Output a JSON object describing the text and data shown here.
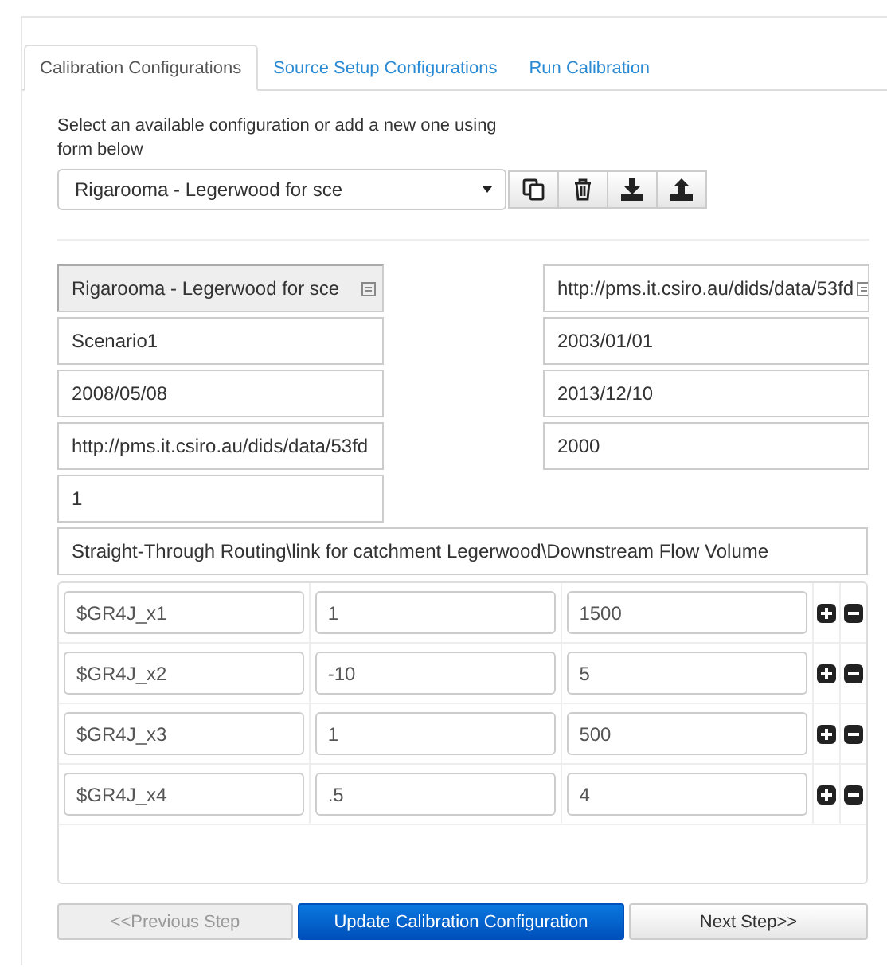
{
  "tabs": [
    {
      "label": "Calibration Configurations",
      "selected": true
    },
    {
      "label": "Source Setup Configurations",
      "selected": false
    },
    {
      "label": "Run Calibration",
      "selected": false
    }
  ],
  "intro": "Select an available configuration or add a new one using form below",
  "config_select": {
    "value": "Rigarooma - Legerwood for sce"
  },
  "toolbar": [
    {
      "kind": "copy"
    },
    {
      "kind": "delete"
    },
    {
      "kind": "download"
    },
    {
      "kind": "upload"
    }
  ],
  "fields_left": [
    {
      "value": "Rigarooma - Legerwood for sce",
      "disabled": true,
      "has_icon": true
    },
    {
      "value": "Scenario1",
      "disabled": false,
      "has_icon": false
    },
    {
      "value": "2008/05/08",
      "disabled": false,
      "has_icon": false
    },
    {
      "value": "http://pms.it.csiro.au/dids/data/53fd",
      "disabled": false,
      "has_icon": false
    },
    {
      "value": "1",
      "disabled": false,
      "has_icon": false
    }
  ],
  "fields_right": [
    {
      "value": "http://pms.it.csiro.au/dids/data/53fd",
      "disabled": false,
      "has_icon": true
    },
    {
      "value": "2003/01/01",
      "disabled": false,
      "has_icon": false
    },
    {
      "value": "2013/12/10",
      "disabled": false,
      "has_icon": false
    },
    {
      "value": "2000",
      "disabled": false,
      "has_icon": false
    }
  ],
  "route": "Straight-Through Routing\\link for catchment Legerwood\\Downstream Flow Volume",
  "parameters": [
    {
      "name": "$GR4J_x1",
      "min": "1",
      "max": "1500"
    },
    {
      "name": "$GR4J_x2",
      "min": "-10",
      "max": "5"
    },
    {
      "name": "$GR4J_x3",
      "min": "1",
      "max": "500"
    },
    {
      "name": "$GR4J_x4",
      "min": ".5",
      "max": "4"
    }
  ],
  "buttons": [
    {
      "label": "<<Previous Step",
      "kind": "default",
      "disabled": true
    },
    {
      "label": "Update Calibration Configuration",
      "kind": "primary",
      "disabled": false
    },
    {
      "label": "Next Step>>",
      "kind": "default",
      "disabled": false
    }
  ]
}
